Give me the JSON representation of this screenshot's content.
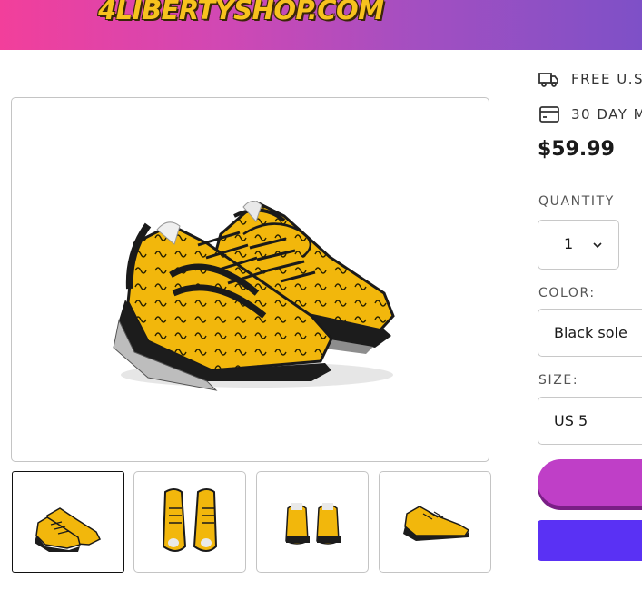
{
  "header": {
    "logo_text": "4LIBERTYSHOP.COM",
    "colors": {
      "gradient_start": "#f23f9b",
      "gradient_end": "#7e50c7",
      "logo": "#f7c21e"
    }
  },
  "gallery": {
    "main_image_icon": "yellow-sneakers-image",
    "thumbnails": [
      {
        "icon": "sneakers-angled-view",
        "selected": true
      },
      {
        "icon": "sneakers-top-view",
        "selected": false
      },
      {
        "icon": "sneakers-back-view",
        "selected": false
      },
      {
        "icon": "sneakers-side-view",
        "selected": false
      }
    ]
  },
  "product": {
    "shipping_text": "FREE U.S.",
    "return_text": "30 DAY M",
    "price": "$59.99",
    "quantity_label": "QUANTITY",
    "quantity_value": "1",
    "color_label": "COLOR:",
    "color_value": "Black sole",
    "size_label": "SIZE:",
    "size_value": "US 5"
  },
  "buttons": {
    "add_to_cart_color": "#bf3fc7",
    "buy_now_color": "#5a31f4"
  }
}
